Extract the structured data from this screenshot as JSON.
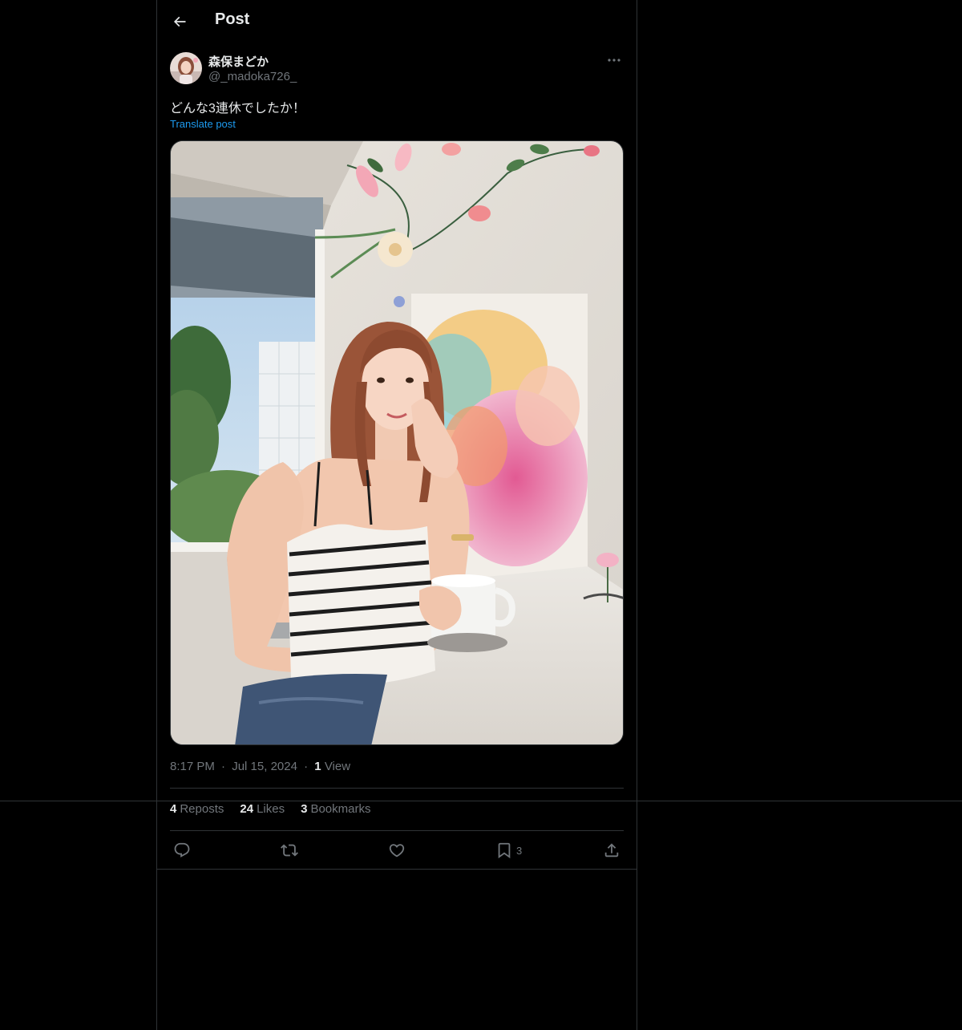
{
  "header": {
    "title": "Post"
  },
  "author": {
    "display_name": "森保まどか",
    "handle": "@_madoka726_"
  },
  "post": {
    "text": "どんな3連休でしたか！",
    "translate_label": "Translate post",
    "media_alt": "Photo of a woman in a striped top sitting at a white table with a mug, in front of a colorful floral painting and paper flowers"
  },
  "meta": {
    "time": "8:17 PM",
    "date": "Jul 15, 2024",
    "separator": "·",
    "views_count": "1",
    "views_label": "View"
  },
  "stats": [
    {
      "count": "4",
      "label": "Reposts"
    },
    {
      "count": "24",
      "label": "Likes"
    },
    {
      "count": "3",
      "label": "Bookmarks"
    }
  ],
  "actions": {
    "bookmark_count": "3"
  },
  "colors": {
    "background": "#000000",
    "divider": "#2f3336",
    "link": "#1d9bf0",
    "muted": "#71767b",
    "text": "#e7e9ea"
  }
}
